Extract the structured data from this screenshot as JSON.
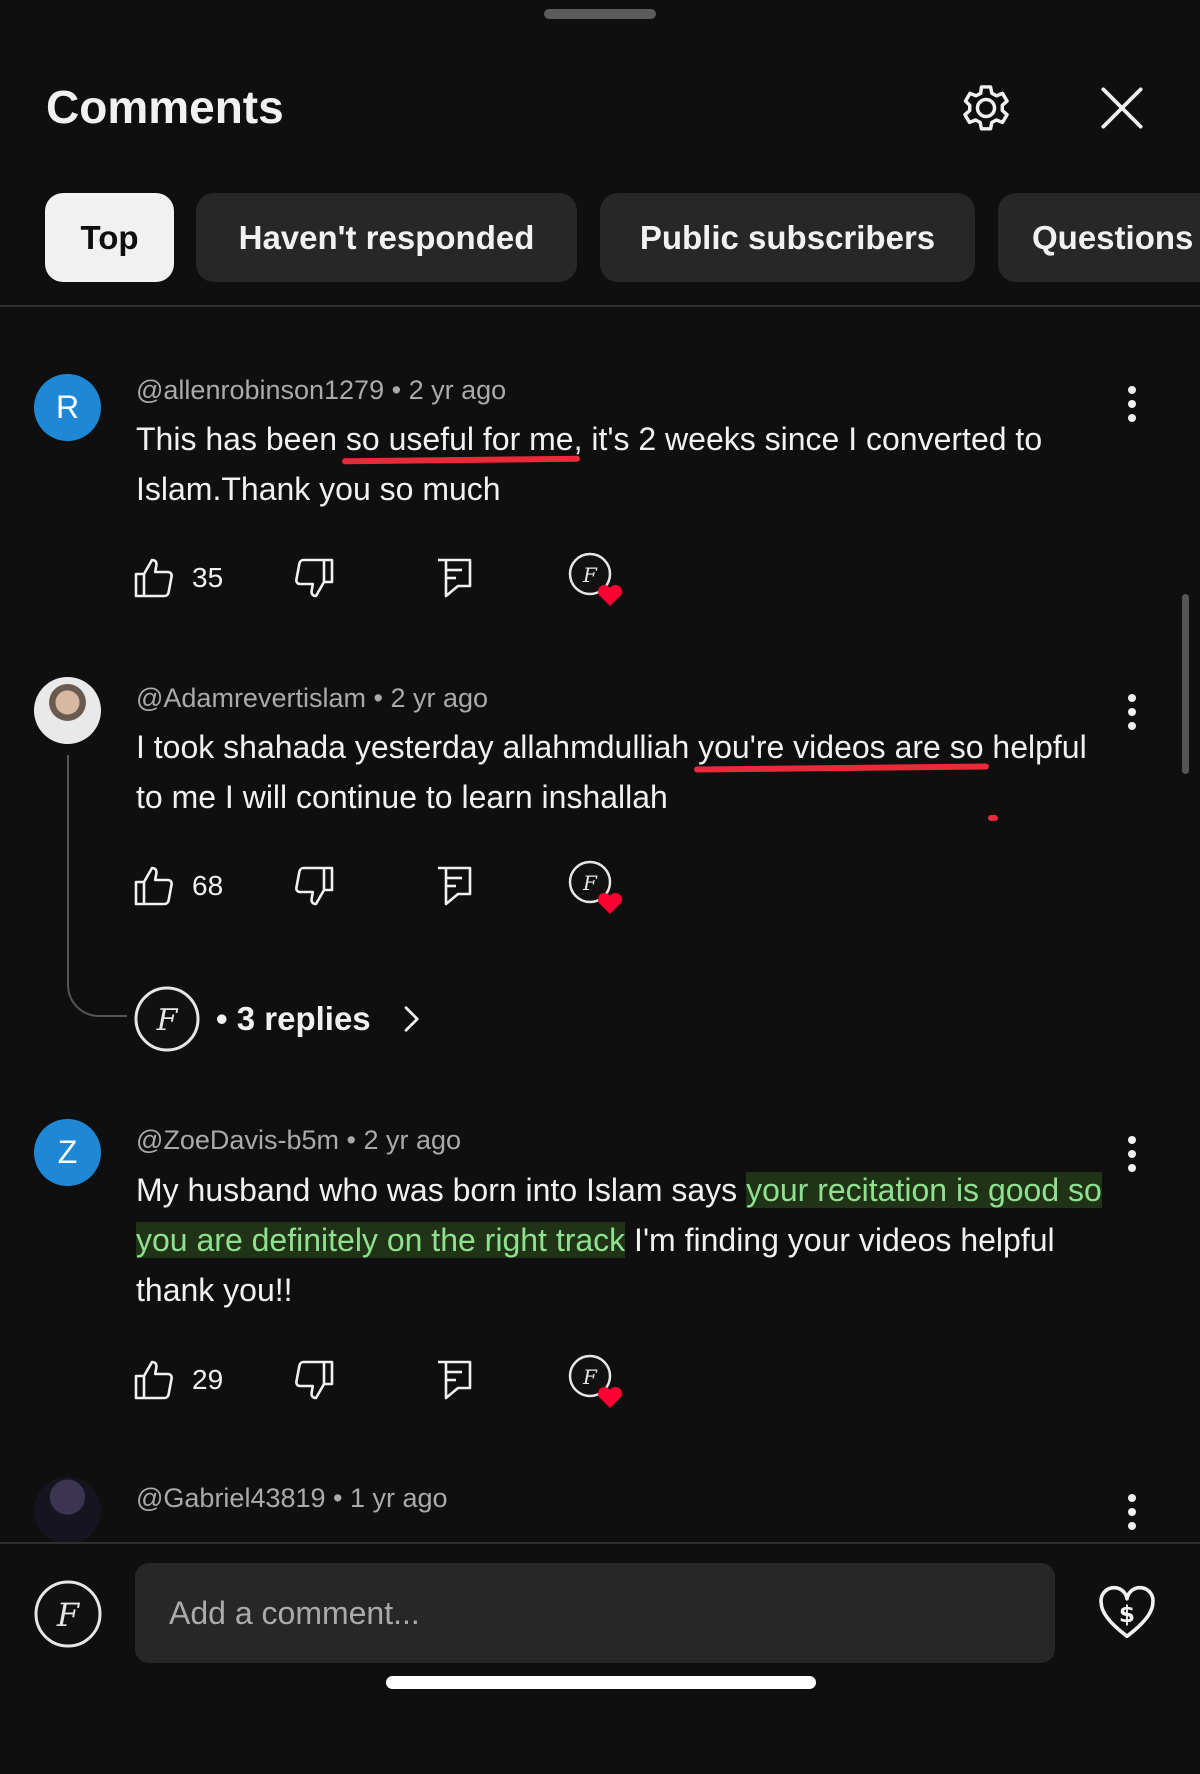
{
  "header": {
    "title": "Comments",
    "settings_icon": "gear-icon",
    "close_icon": "close-icon"
  },
  "filters": [
    {
      "label": "Top",
      "active": true
    },
    {
      "label": "Haven't responded",
      "active": false
    },
    {
      "label": "Public subscribers",
      "active": false
    },
    {
      "label": "Questions",
      "active": false
    }
  ],
  "comments": [
    {
      "avatar_letter": "R",
      "author": "@allenrobinson1279",
      "time": "2 yr ago",
      "text_before": "This has been",
      "text_underlined": "so useful for me",
      "text_after": ", it's 2 weeks since I converted to Islam.Thank you so much",
      "likes": "35"
    },
    {
      "author": "@Adamrevertislam",
      "time": "2 yr ago",
      "text_before": "I took shahada yesterday allahmdulliah",
      "text_underlined_1": "you're videos are so",
      "text_underlined_2": "helpful to me",
      "text_after": "I will continue to learn inshallah",
      "likes": "68",
      "replies_label": "3 replies"
    },
    {
      "avatar_letter": "Z",
      "author": "@ZoeDavis-b5m",
      "time": "2 yr ago",
      "text_before": "My husband who was born into Islam says",
      "text_highlighted": "your recitation is good so you are definitely on the right track",
      "text_after": "I'm finding your videos helpful thank you!!",
      "likes": "29"
    },
    {
      "author": "@Gabriel43819",
      "time": "1 yr ago"
    }
  ],
  "meta_separator": "•",
  "composer": {
    "placeholder": "Add a comment...",
    "thanks_icon": "heart-dollar-icon"
  },
  "colors": {
    "background": "#0f0f0f",
    "chip_bg": "#272727",
    "chip_active_bg": "#f1f1f1",
    "avatar_blue": "#1e88d6",
    "heart_red": "#ff0033",
    "underline_red": "#ea2a3a",
    "highlight_green": "#8fe08f"
  }
}
